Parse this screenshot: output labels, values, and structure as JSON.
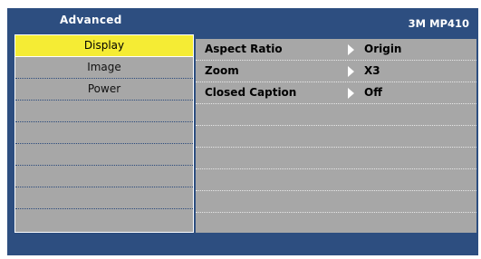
{
  "header": {
    "title": "Advanced",
    "model": "3M MP410"
  },
  "menu": {
    "items": [
      {
        "label": "Display",
        "selected": true
      },
      {
        "label": "Image",
        "selected": false
      },
      {
        "label": "Power",
        "selected": false
      },
      {
        "label": "",
        "selected": false
      },
      {
        "label": "",
        "selected": false
      },
      {
        "label": "",
        "selected": false
      },
      {
        "label": "",
        "selected": false
      },
      {
        "label": "",
        "selected": false
      },
      {
        "label": "",
        "selected": false
      }
    ]
  },
  "settings": [
    {
      "label": "Aspect Ratio",
      "value": "Origin",
      "icon": "right-arrow-icon"
    },
    {
      "label": "Zoom",
      "value": "X3",
      "icon": "right-arrow-icon"
    },
    {
      "label": "Closed Caption",
      "value": "Off",
      "icon": "right-arrow-icon"
    },
    {
      "label": "",
      "value": ""
    },
    {
      "label": "",
      "value": ""
    },
    {
      "label": "",
      "value": ""
    },
    {
      "label": "",
      "value": ""
    },
    {
      "label": "",
      "value": ""
    },
    {
      "label": "",
      "value": ""
    }
  ],
  "colors": {
    "frame": "#2d4e80",
    "panel": "#a7a7a7",
    "highlight": "#f5ec34",
    "text_light": "#ffffff"
  }
}
